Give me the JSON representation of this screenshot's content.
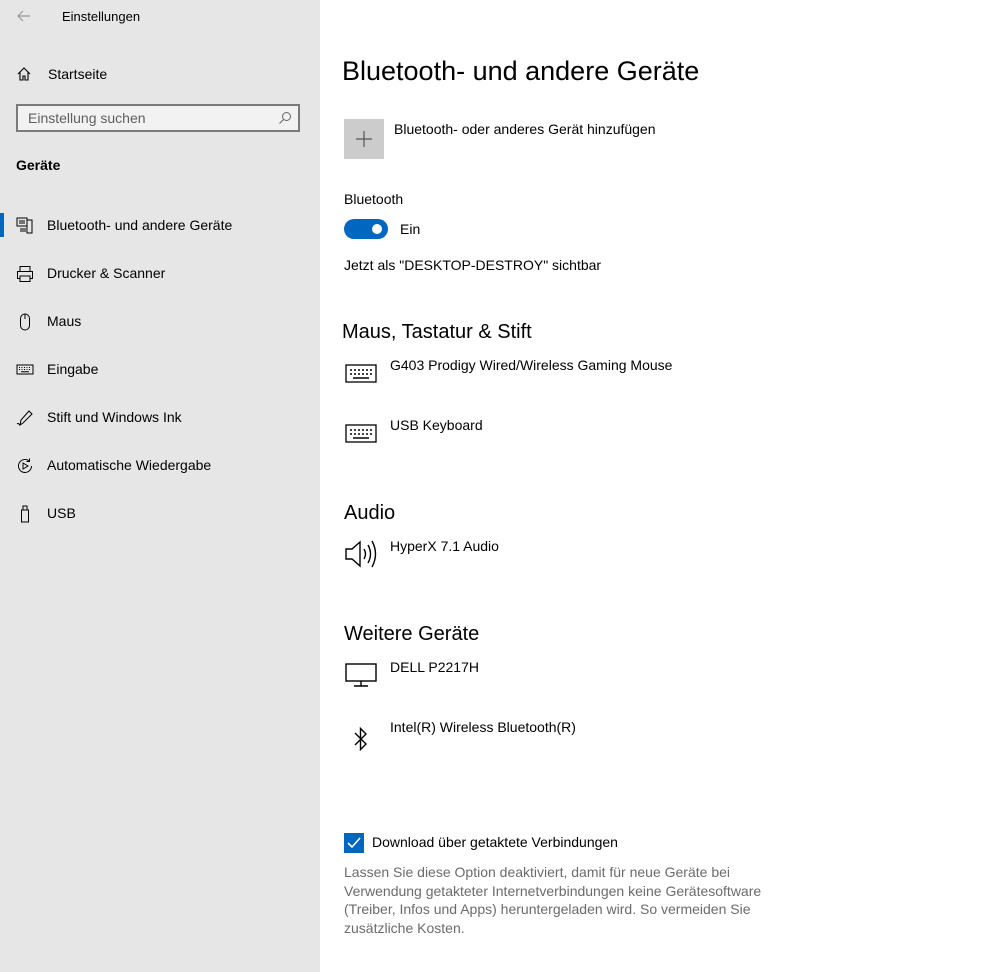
{
  "app": {
    "title": "Einstellungen"
  },
  "sidebar": {
    "home_label": "Startseite",
    "search_placeholder": "Einstellung suchen",
    "section": "Geräte",
    "items": [
      {
        "label": "Bluetooth- und andere Geräte",
        "icon": "bluetooth-devices-icon",
        "active": true
      },
      {
        "label": "Drucker & Scanner",
        "icon": "printer-icon"
      },
      {
        "label": "Maus",
        "icon": "mouse-icon"
      },
      {
        "label": "Eingabe",
        "icon": "keyboard-icon"
      },
      {
        "label": "Stift und Windows Ink",
        "icon": "pen-icon"
      },
      {
        "label": "Automatische Wiedergabe",
        "icon": "autoplay-icon"
      },
      {
        "label": "USB",
        "icon": "usb-icon"
      }
    ]
  },
  "main": {
    "title": "Bluetooth- und andere Geräte",
    "add_device_label": "Bluetooth- oder anderes Gerät hinzufügen",
    "bluetooth": {
      "label": "Bluetooth",
      "toggle_state": "Ein",
      "visible_text": "Jetzt als \"DESKTOP-DESTROY\" sichtbar"
    },
    "groups": [
      {
        "title": "Maus, Tastatur & Stift",
        "devices": [
          {
            "name": "G403 Prodigy Wired/Wireless Gaming Mouse",
            "icon": "keyboard-icon"
          },
          {
            "name": "USB Keyboard",
            "icon": "keyboard-icon"
          }
        ]
      },
      {
        "title": "Audio",
        "devices": [
          {
            "name": "HyperX 7.1 Audio",
            "icon": "speaker-icon"
          }
        ]
      },
      {
        "title": "Weitere Geräte",
        "devices": [
          {
            "name": "DELL P2217H",
            "icon": "monitor-icon"
          },
          {
            "name": "Intel(R) Wireless Bluetooth(R)",
            "icon": "bluetooth-icon"
          }
        ]
      }
    ],
    "metered": {
      "label": "Download über getaktete Verbindungen",
      "checked": true,
      "description": "Lassen Sie diese Option deaktiviert, damit für neue Geräte bei Verwendung getakteter Internetverbindungen keine Gerätesoftware (Treiber, Infos und Apps) heruntergeladen wird. So vermeiden Sie zusätzliche Kosten."
    }
  },
  "colors": {
    "accent": "#0067c0",
    "sidebar_bg": "#e6e6e6",
    "add_button_bg": "#cccccc"
  }
}
